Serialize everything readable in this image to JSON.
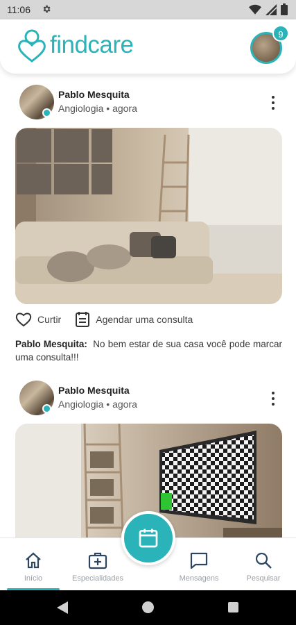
{
  "status_bar": {
    "time": "11:06"
  },
  "header": {
    "logo_text": "findcare",
    "notification_count": "9"
  },
  "posts": [
    {
      "author": "Pablo Mesquita",
      "specialty": "Angiologia",
      "separator": "•",
      "time": "agora",
      "like_label": "Curtir",
      "schedule_label": "Agendar uma consulta",
      "caption_author": "Pablo Mesquita:",
      "caption_text": "No bem estar de sua casa você pode marcar uma consulta!!!",
      "image": "living-room-sofa-photo"
    },
    {
      "author": "Pablo Mesquita",
      "specialty": "Angiologia",
      "separator": "•",
      "time": "agora",
      "image": "living-room-tv-checkerboard-photo"
    }
  ],
  "bottom_nav": {
    "items": [
      {
        "label": "Início",
        "icon": "home-icon",
        "active": true
      },
      {
        "label": "Especialidades",
        "icon": "medical-bag-icon",
        "active": false
      },
      {
        "label": "Mensagens",
        "icon": "chat-icon",
        "active": false
      },
      {
        "label": "Pesquisar",
        "icon": "search-icon",
        "active": false
      }
    ],
    "fab_icon": "calendar-icon"
  },
  "colors": {
    "accent": "#2ab3b8",
    "status_bar": "#d7d7d7",
    "nav_label": "#9aa0a6"
  }
}
